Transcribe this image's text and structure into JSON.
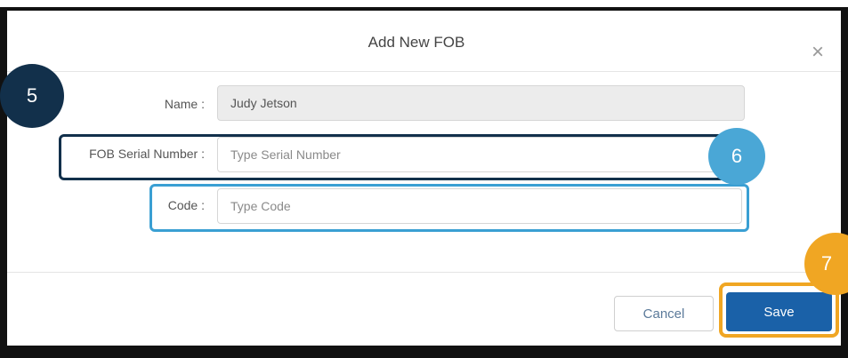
{
  "dialog": {
    "title": "Add New FOB",
    "close_glyph": "×",
    "fields": {
      "name": {
        "label": "Name :",
        "value": "Judy Jetson"
      },
      "serial": {
        "label": "FOB Serial Number :",
        "placeholder": "Type Serial Number"
      },
      "code": {
        "label": "Code :",
        "placeholder": "Type Code"
      }
    },
    "buttons": {
      "cancel": "Cancel",
      "save": "Save"
    }
  },
  "callouts": {
    "step5": "5",
    "step6": "6",
    "step7": "7"
  },
  "colors": {
    "step5": "#12304b",
    "step6": "#4aa7d6",
    "step7": "#f0a623",
    "primary": "#1a61a8"
  }
}
